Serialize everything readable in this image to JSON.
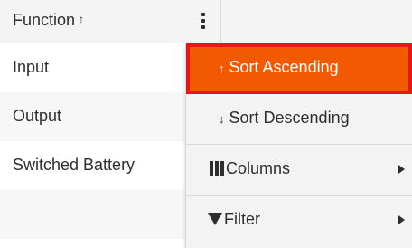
{
  "grid": {
    "header": {
      "function_label": "Function",
      "sort_indicator": "↑"
    },
    "rows": [
      {
        "function": "Input"
      },
      {
        "function": "Output"
      },
      {
        "function": "Switched Battery"
      }
    ]
  },
  "column_menu": {
    "sort_ascending": {
      "icon": "↑",
      "label": "Sort Ascending"
    },
    "sort_descending": {
      "icon": "↓",
      "label": "Sort Descending"
    },
    "columns": {
      "icon": "columns-icon",
      "label": "Columns"
    },
    "filter": {
      "icon": "filter-icon",
      "label": "Filter"
    }
  },
  "colors": {
    "highlight_fill": "#f35a00",
    "highlight_border": "#e8161b",
    "menu_background": "#f3f3f3",
    "header_background": "#f4f4f4"
  }
}
